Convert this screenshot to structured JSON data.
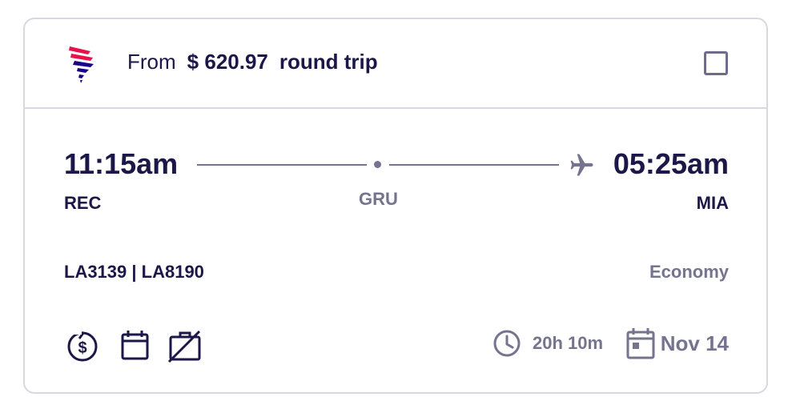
{
  "header": {
    "from_label": "From",
    "price": "$ 620.97",
    "trip_type": "round trip",
    "select_checked": false,
    "airline_logo": "latam-logo"
  },
  "route": {
    "departure_time": "11:15am",
    "departure_airport": "REC",
    "stop_airport": "GRU",
    "arrival_time": "05:25am",
    "arrival_airport": "MIA"
  },
  "details": {
    "flight_numbers": "LA3139 | LA8190",
    "cabin": "Economy",
    "duration": "20h 10m",
    "date": "Nov 14"
  },
  "features": [
    {
      "icon": "refundable-icon"
    },
    {
      "icon": "calendar-change-icon"
    },
    {
      "icon": "no-checked-bag-icon"
    }
  ],
  "colors": {
    "primary_text": "#1b1748",
    "secondary_text": "#76738f",
    "border": "#d8d8e2",
    "logo_red": "#e8114b",
    "logo_navy": "#1b0088"
  }
}
